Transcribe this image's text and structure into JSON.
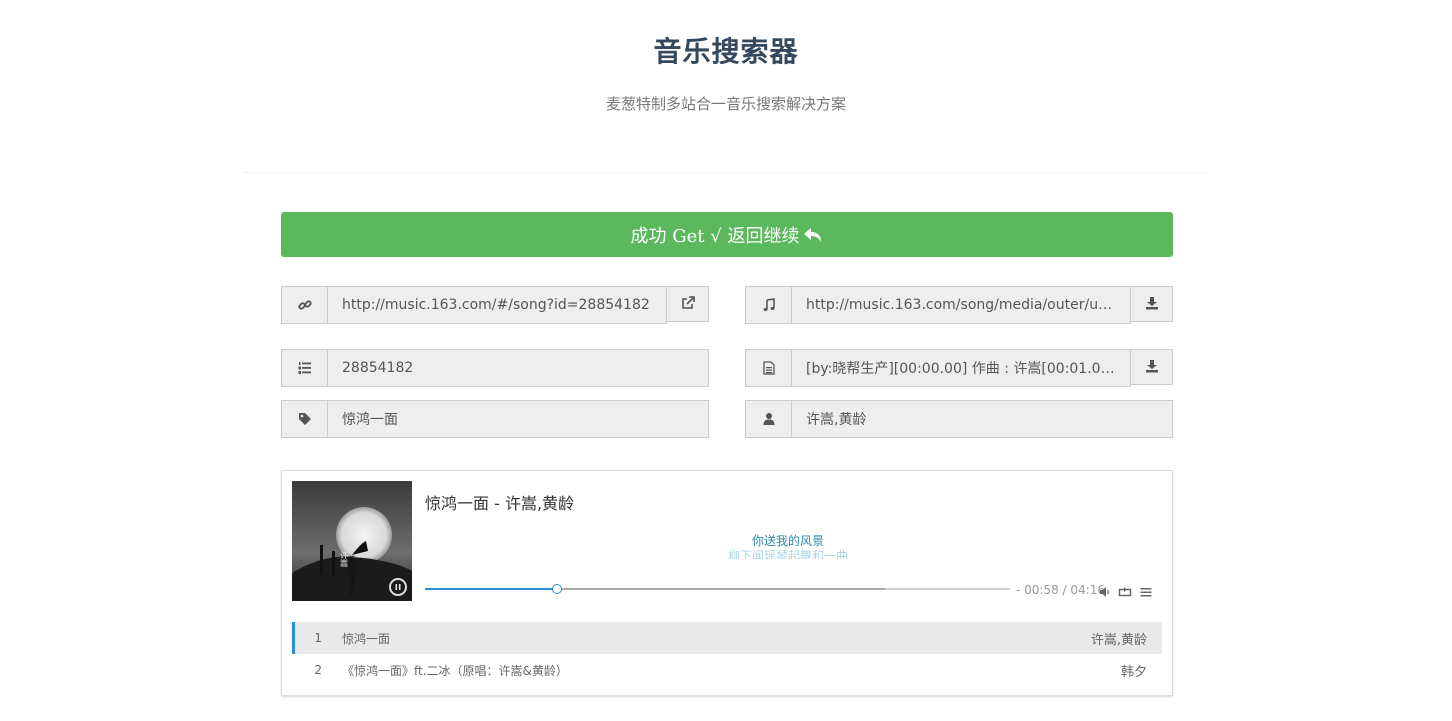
{
  "header": {
    "title": "音乐搜索器",
    "subtitle": "麦葱特制多站合一音乐搜索解决方案"
  },
  "success_button": {
    "label": "成功 Get √ 返回继续"
  },
  "fields": {
    "song_link": {
      "icon": "link-icon",
      "value": "http://music.163.com/#/song?id=28854182",
      "button_icon": "external-link-icon"
    },
    "song_url": {
      "icon": "music-icon",
      "value": "http://music.163.com/song/media/outer/url?id=...",
      "button_icon": "download-icon"
    },
    "song_id": {
      "icon": "list-ol-icon",
      "value": "28854182"
    },
    "lyrics": {
      "icon": "file-text-icon",
      "value": "[by:晓帮生产][00:00.00] 作曲 : 许嵩[00:01.00] 作...",
      "button_icon": "download-icon"
    },
    "song_name": {
      "icon": "tag-icon",
      "value": "惊鸿一面"
    },
    "artist": {
      "icon": "user-icon",
      "value": "许嵩,黄龄"
    }
  },
  "player": {
    "title": "惊鸿一面 - 许嵩,黄龄",
    "lyric_current": "你送我的风景",
    "lyric_next": "柳下闻瑶琴起舞和一曲",
    "time": "- 00:58 / 04:16",
    "played_fraction": 0.226,
    "loaded_fraction": 0.786,
    "cover_text_a": "不如吃茶去",
    "cover_text_b": "许嵩",
    "playlist": [
      {
        "index": "1",
        "name": "惊鸿一面",
        "artist": "许嵩,黄龄"
      },
      {
        "index": "2",
        "name": "《惊鸿一面》ft.二冰（原唱：许嵩&黄龄）",
        "artist": "韩夕"
      }
    ]
  },
  "colors": {
    "success": "#5cb85c",
    "accent": "#2c8ed6",
    "title": "#34495e"
  }
}
